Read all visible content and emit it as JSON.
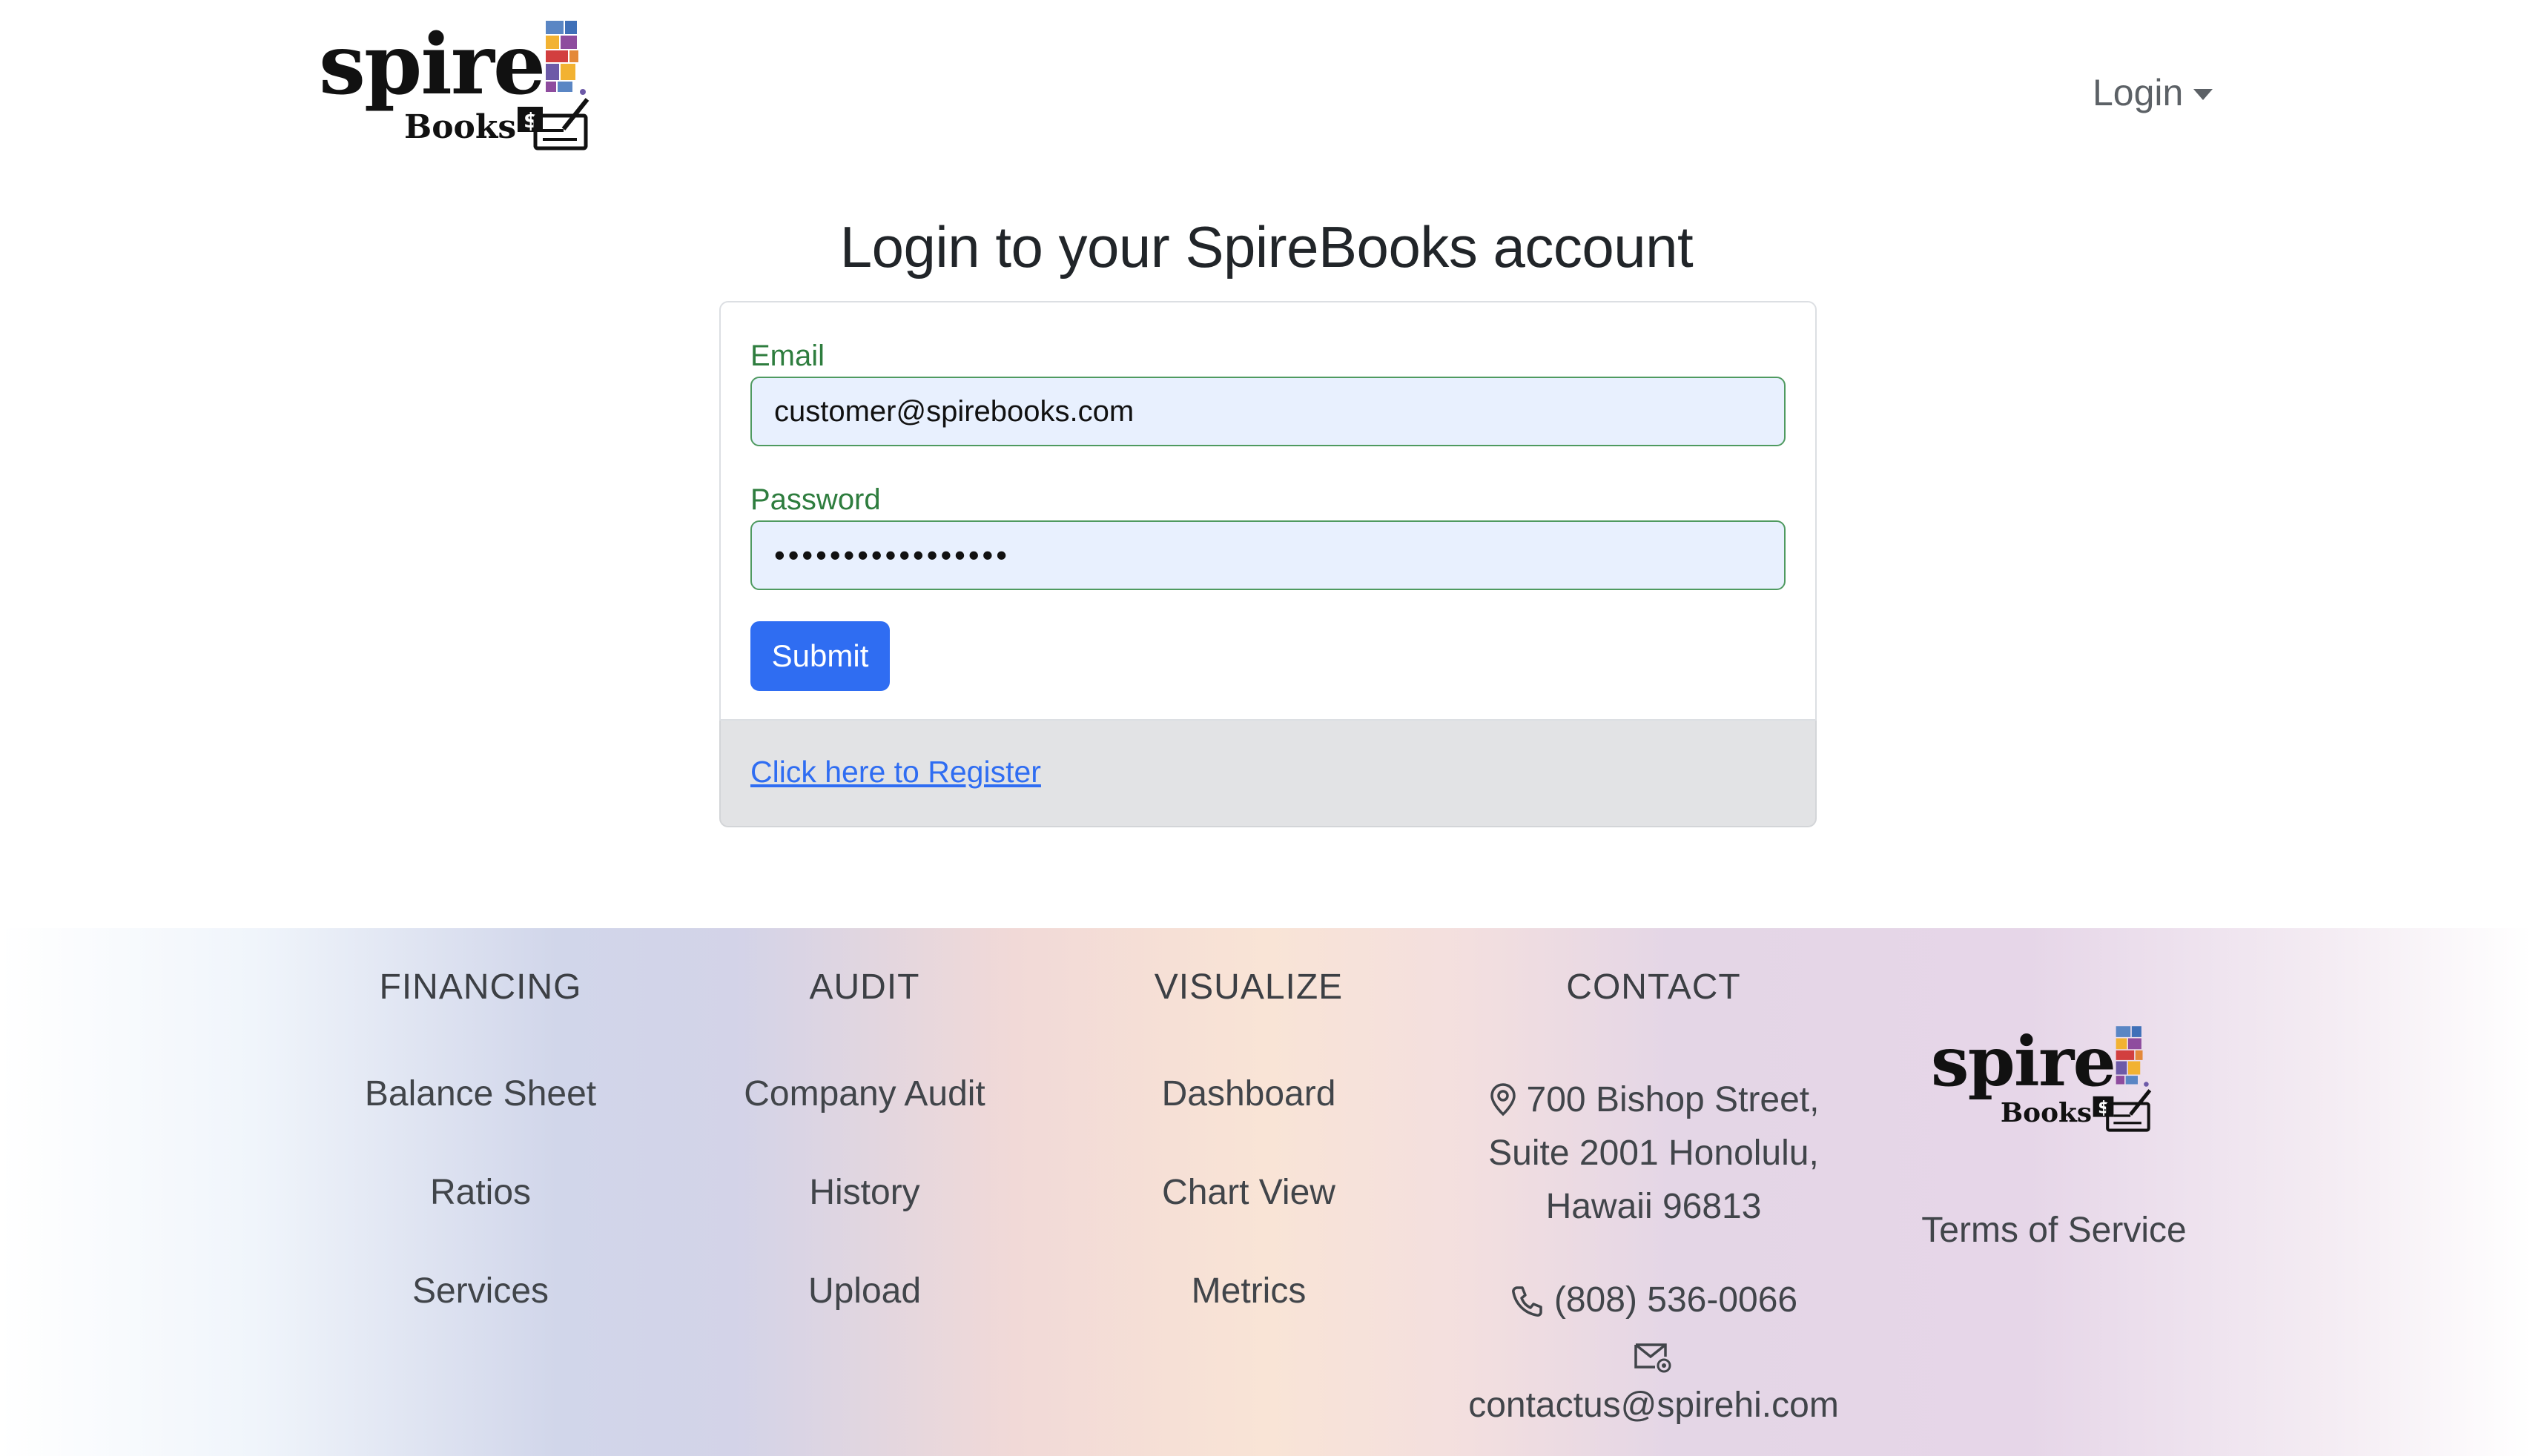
{
  "brand": {
    "logo_word": "spire",
    "logo_sub": "Books",
    "logo_badge": "$",
    "tile_colors": [
      "#5a86c4",
      "#8e4c9e",
      "#e4893a",
      "#d23f3f",
      "#6d5aa8",
      "#f2b232",
      "#3f70b8"
    ]
  },
  "nav": {
    "login_label": "Login"
  },
  "page": {
    "title": "Login to your SpireBooks account"
  },
  "form": {
    "email_label": "Email",
    "email_value": "customer@spirebooks.com",
    "password_label": "Password",
    "password_value": "•••••••••••••••••",
    "submit_label": "Submit",
    "register_link": "Click here to Register"
  },
  "footer": {
    "financing": {
      "heading": "FINANCING",
      "links": [
        "Balance Sheet",
        "Ratios",
        "Services"
      ]
    },
    "audit": {
      "heading": "AUDIT",
      "links": [
        "Company Audit",
        "History",
        "Upload"
      ]
    },
    "visualize": {
      "heading": "VISUALIZE",
      "links": [
        "Dashboard",
        "Chart View",
        "Metrics"
      ]
    },
    "contact": {
      "heading": "CONTACT",
      "address_lines": [
        "700 Bishop Street,",
        "Suite 2001 Honolulu,",
        "Hawaii 96813"
      ],
      "phone": "(808) 536-0066",
      "email": "contactus@spirehi.com"
    },
    "terms": "Terms of Service"
  },
  "colors": {
    "primary_button": "#2f6df2",
    "field_label": "#2e7d3e",
    "input_fill": "#e8f0fe"
  }
}
